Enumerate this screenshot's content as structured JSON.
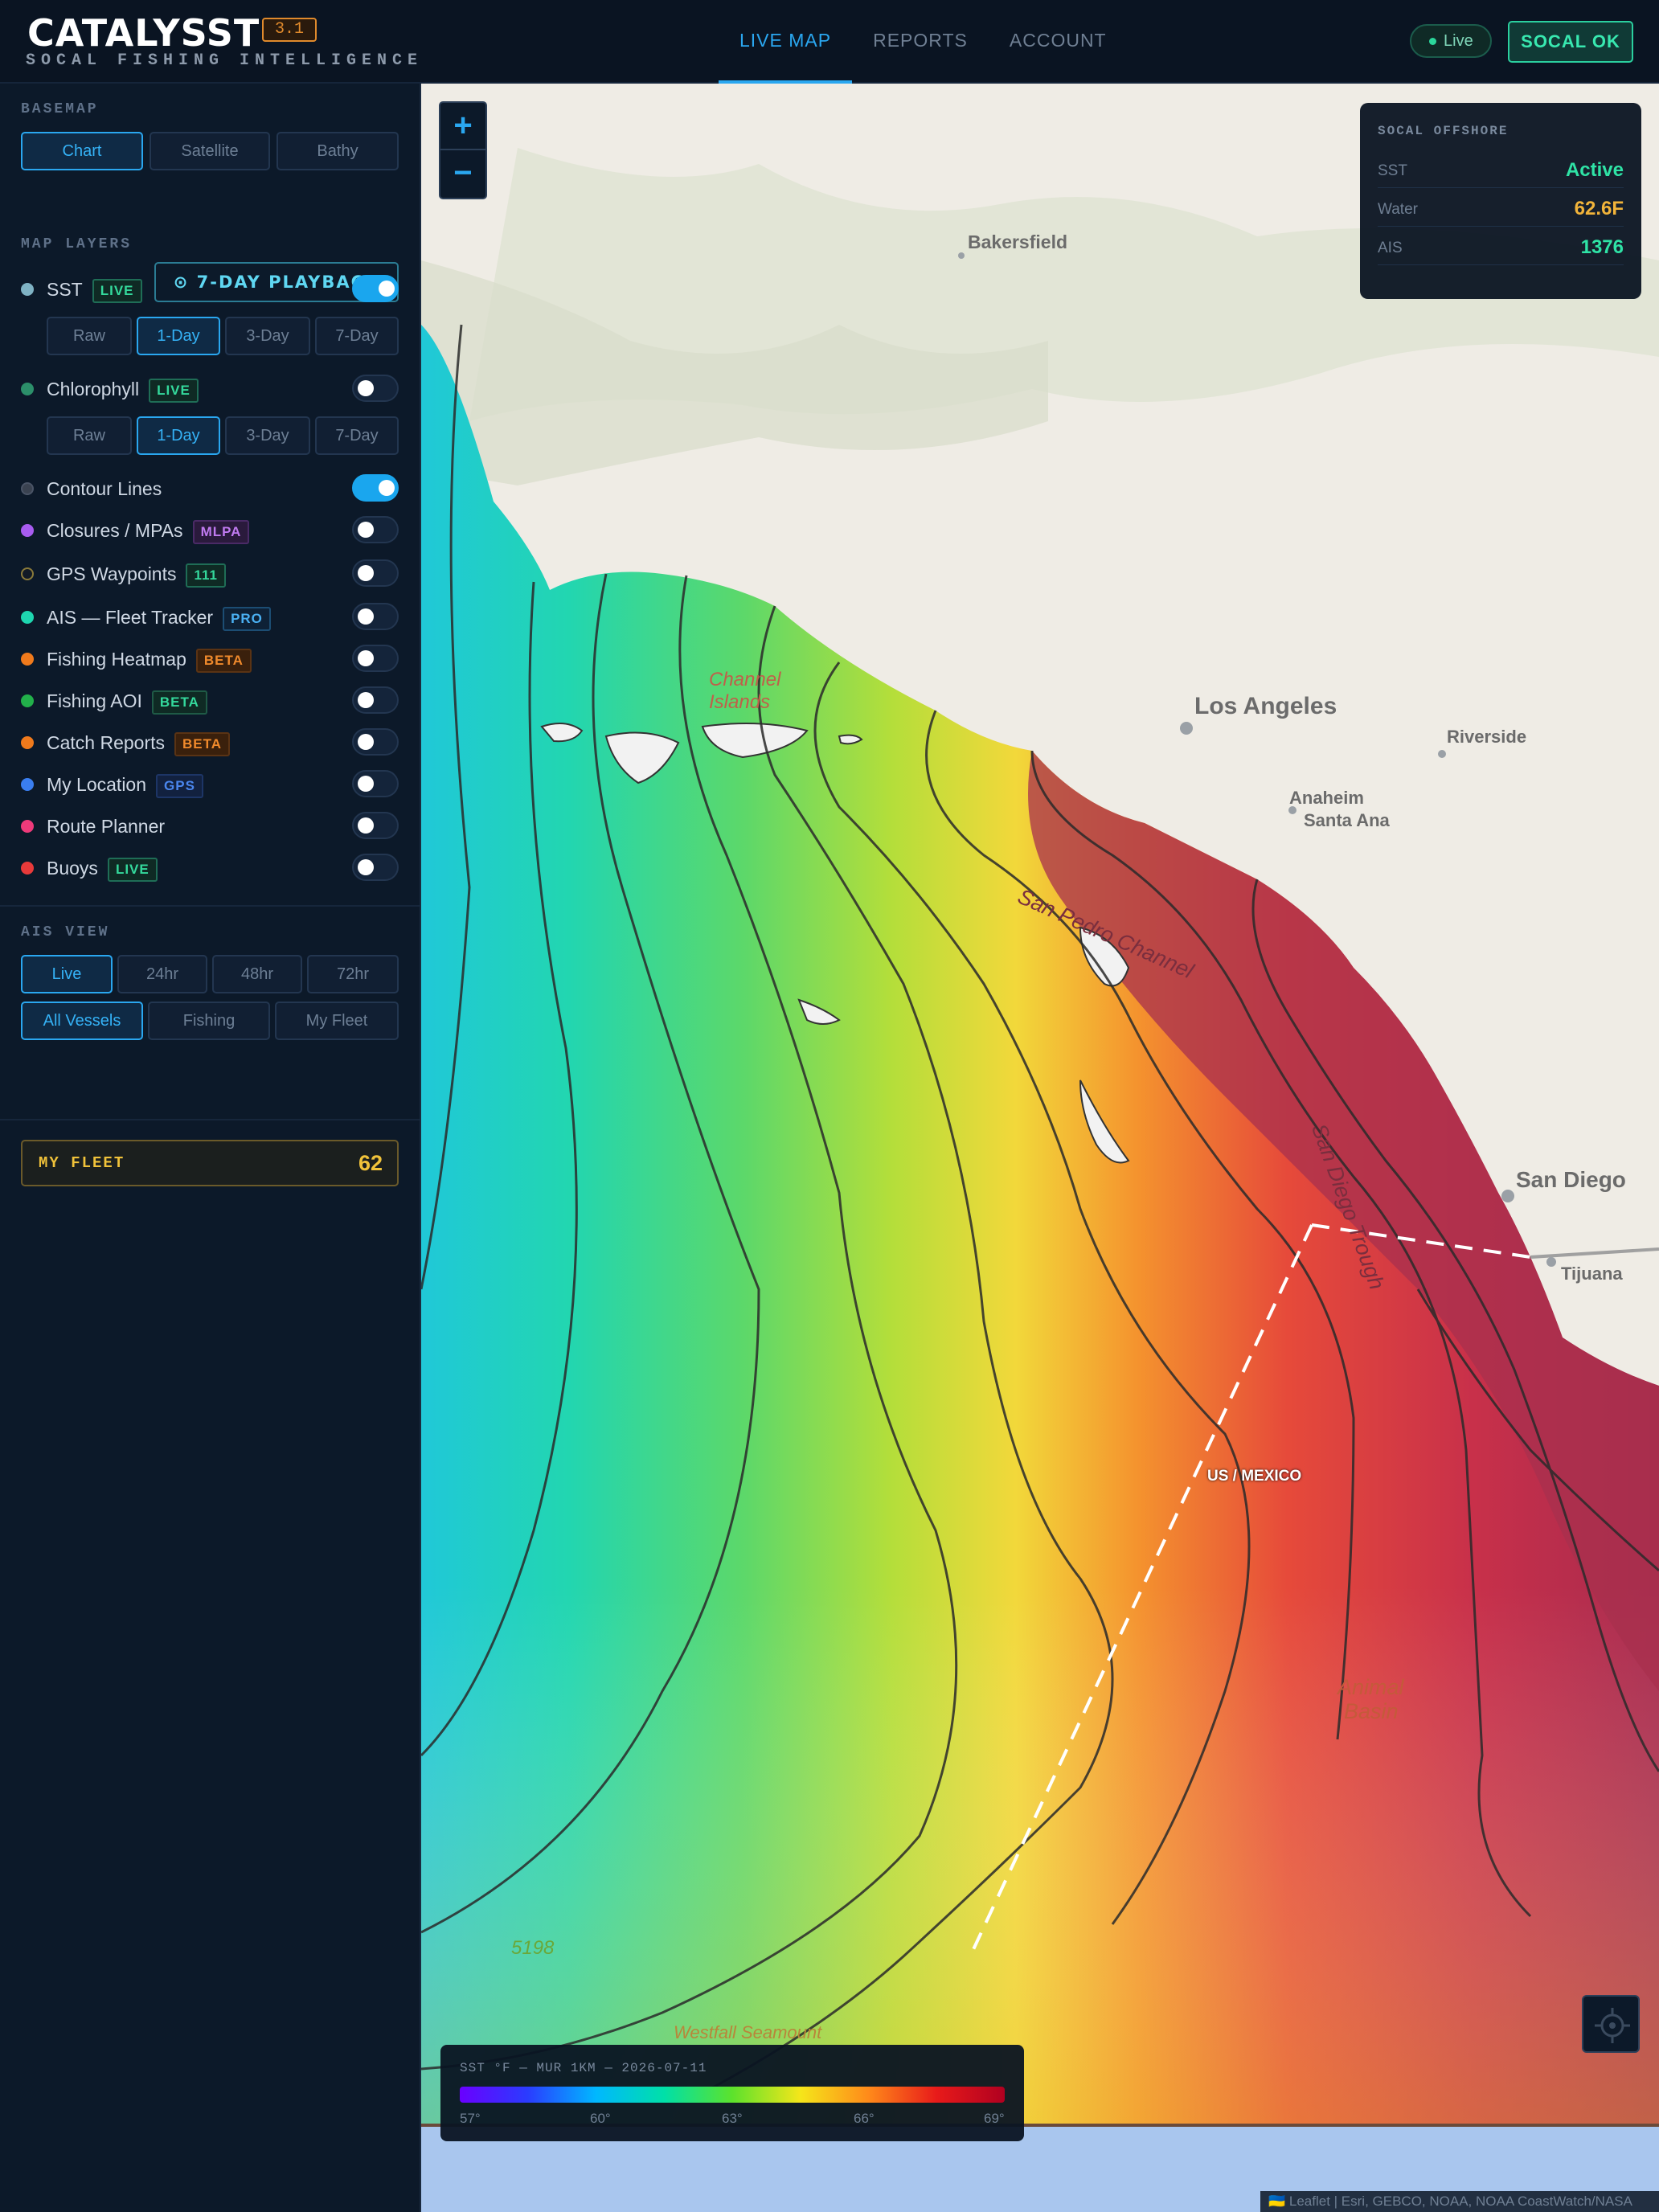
{
  "header": {
    "logo": "CATALYSST",
    "version": "3.1",
    "tagline": "SOCAL FISHING INTELLIGENCE",
    "nav": [
      "LIVE MAP",
      "REPORTS",
      "ACCOUNT"
    ],
    "active_nav": "LIVE MAP",
    "live_label": "Live",
    "region_button": "SOCAL OK"
  },
  "sidebar": {
    "basemap_label": "BASEMAP",
    "basemap_options": [
      "Chart",
      "Satellite",
      "Bathy"
    ],
    "basemap_selected": "Chart",
    "playback_label": "⊙ 7-DAY PLAYBACK",
    "layers_label": "MAP LAYERS",
    "layers": [
      {
        "name": "SST",
        "badge": "LIVE",
        "on": true,
        "dot": "#7fb2c4"
      },
      {
        "name": "Chlorophyll",
        "badge": "LIVE",
        "on": false,
        "dot": "#2c8f6a"
      },
      {
        "name": "Contour Lines",
        "badge": "",
        "on": true,
        "dot": "#3a4250"
      },
      {
        "name": "Closures / MPAs",
        "badge": "MLPA",
        "on": false,
        "dot": "#a85cf0"
      },
      {
        "name": "GPS Waypoints",
        "badge": "111",
        "on": false,
        "dot": "#111a26"
      },
      {
        "name": "AIS — Fleet Tracker",
        "badge": "PRO",
        "on": false,
        "dot": "#1ed6b0"
      },
      {
        "name": "Fishing Heatmap",
        "badge": "BETA",
        "on": false,
        "dot": "#f07a1c"
      },
      {
        "name": "Fishing AOI",
        "badge": "BETA",
        "on": false,
        "dot": "#22b04a"
      },
      {
        "name": "Catch Reports",
        "badge": "BETA",
        "on": false,
        "dot": "#f07a1c"
      },
      {
        "name": "My Location",
        "badge": "GPS",
        "on": false,
        "dot": "#3a7ef0"
      },
      {
        "name": "Route Planner",
        "badge": "",
        "on": false,
        "dot": "#ee3a7a"
      },
      {
        "name": "Buoys",
        "badge": "LIVE",
        "on": false,
        "dot": "#e83a3a"
      }
    ],
    "sst_periods": [
      "Raw",
      "1-Day",
      "3-Day",
      "7-Day"
    ],
    "sst_period_selected": "1-Day",
    "chl_periods": [
      "Raw",
      "1-Day",
      "3-Day",
      "7-Day"
    ],
    "chl_period_selected": "1-Day",
    "ais_label": "AIS VIEW",
    "ais_times": [
      "Live",
      "24hr",
      "48hr",
      "72hr"
    ],
    "ais_time_selected": "Live",
    "ais_filters": [
      "All Vessels",
      "Fishing",
      "My Fleet"
    ],
    "ais_filter_selected": "All Vessels",
    "fleet_label": "MY FLEET",
    "fleet_count": "62"
  },
  "map": {
    "zoom_in": "+",
    "zoom_out": "−",
    "panel": {
      "title": "SOCAL OFFSHORE",
      "rows": [
        {
          "k": "SST",
          "v": "Active",
          "color": "#2fe3a6"
        },
        {
          "k": "Water",
          "v": "62.6F",
          "color": "#f2b43a"
        },
        {
          "k": "AIS",
          "v": "1376",
          "color": "#2fe3a6"
        }
      ]
    },
    "labels": {
      "bakersfield": "Bakersfield",
      "los_angeles": "Los Angeles",
      "riverside": "Riverside",
      "anaheim": "Anaheim",
      "santa_ana": "Santa Ana",
      "san_diego": "San Diego",
      "tijuana": "Tijuana",
      "channel_islands_1": "Channel",
      "channel_islands_2": "Islands",
      "san_pedro_channel": "San Pedro Channel",
      "san_diego_trough": "San Diego Trough",
      "border": "US / MEXICO",
      "animal_basin_1": "Animal",
      "animal_basin_2": "Basin",
      "depth": "5198",
      "seamount": "Westfall Seamount"
    },
    "legend": {
      "title": "SST °F — MUR 1KM — 2026-07-11",
      "ticks": [
        "57°",
        "60°",
        "63°",
        "66°",
        "69°"
      ]
    },
    "attribution": "🇺🇦 Leaflet | Esri, GEBCO, NOAA, NOAA CoastWatch/NASA"
  }
}
